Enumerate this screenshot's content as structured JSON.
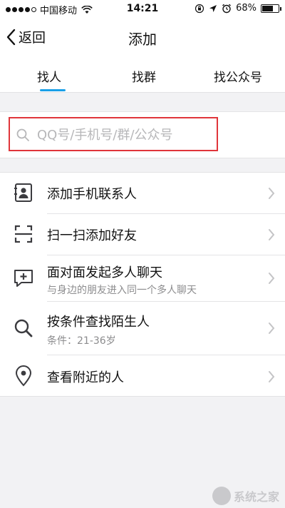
{
  "status_bar": {
    "carrier": "中国移动",
    "time": "14:21",
    "battery_text": "68%",
    "battery_level": 0.68
  },
  "nav": {
    "back_label": "返回",
    "title": "添加"
  },
  "tabs": [
    {
      "label": "找人",
      "active": true
    },
    {
      "label": "找群",
      "active": false
    },
    {
      "label": "找公众号",
      "active": false
    }
  ],
  "search": {
    "placeholder": "QQ号/手机号/群/公众号"
  },
  "items": [
    {
      "icon": "contact-card-icon",
      "title": "添加手机联系人",
      "subtitle": ""
    },
    {
      "icon": "scan-icon",
      "title": "扫一扫添加好友",
      "subtitle": ""
    },
    {
      "icon": "chat-plus-icon",
      "title": "面对面发起多人聊天",
      "subtitle": "与身边的朋友进入同一个多人聊天"
    },
    {
      "icon": "search-icon",
      "title": "按条件查找陌生人",
      "subtitle": "条件：21-36岁"
    },
    {
      "icon": "location-pin-icon",
      "title": "查看附近的人",
      "subtitle": ""
    }
  ],
  "watermark": {
    "text": "系统之家"
  },
  "colors": {
    "accent": "#1aa0e8",
    "highlight_border": "#e0353a",
    "background": "#f2f2f4"
  }
}
